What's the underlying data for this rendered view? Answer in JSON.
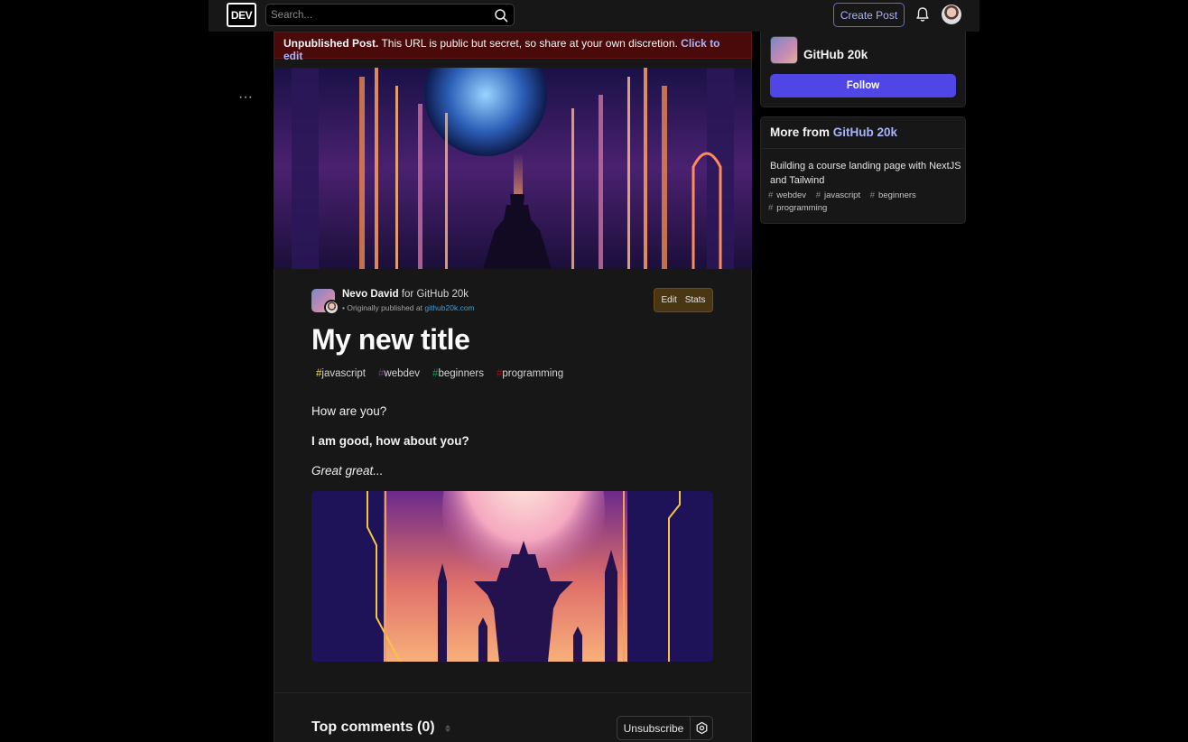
{
  "header": {
    "logo_text": "DEV",
    "search_placeholder": "Search...",
    "create_post_label": "Create Post"
  },
  "sidebar_left": {
    "more_glyph": "···"
  },
  "banner": {
    "strong": "Unpublished Post.",
    "text": " This URL is public but secret, so share at your own discretion. ",
    "link": "Click to edit"
  },
  "article": {
    "author_name": "Nevo David",
    "for_text": " for ",
    "org_name": "GitHub 20k",
    "orig_prefix": "• Originally published at ",
    "orig_link": "github20k.com",
    "edit_label": "Edit",
    "stats_label": "Stats",
    "title": "My new title",
    "tags": [
      {
        "hash": "#",
        "name": "javascript",
        "color": "#f7df1e"
      },
      {
        "hash": "#",
        "name": "webdev",
        "color": "#562765"
      },
      {
        "hash": "#",
        "name": "beginners",
        "color": "#008335"
      },
      {
        "hash": "#",
        "name": "programming",
        "color": "#890606"
      }
    ],
    "paragraph1": "How are you?",
    "paragraph2": "I am good, how about you?",
    "paragraph3": "Great great..."
  },
  "comments": {
    "title": "Top comments (0)",
    "unsubscribe_label": "Unsubscribe"
  },
  "sidebar_right": {
    "org_name": "GitHub 20k",
    "follow_label": "Follow",
    "more_from_prefix": "More from ",
    "more_from_org": "GitHub 20k",
    "related_post_title": "Building a course landing page with NextJS and Tailwind",
    "related_tags": [
      "webdev",
      "javascript",
      "beginners",
      "programming"
    ]
  },
  "colors": {
    "accent": "#4f46e5",
    "banner_bg": "#4a0a0a",
    "link": "#a5b4fc"
  }
}
